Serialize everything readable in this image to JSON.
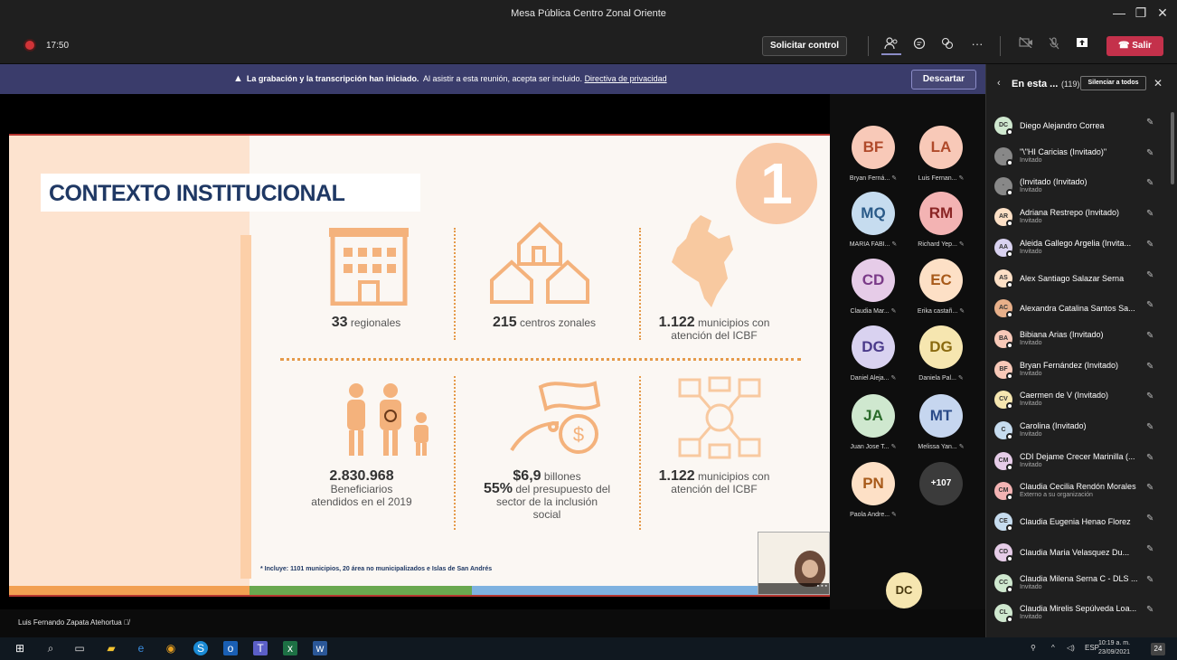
{
  "window": {
    "title": "Mesa Pública Centro Zonal Oriente",
    "minimize": "—",
    "maximize": "❐",
    "close": "✕"
  },
  "toolbar": {
    "timer": "17:50",
    "request_control": "Solicitar control",
    "participants_icon": "people-icon",
    "chat_icon": "chat-icon",
    "reactions_icon": "reactions-icon",
    "more": "···",
    "leave": "Salir"
  },
  "banner": {
    "bold": "La grabación y la transcripción han iniciado.",
    "text": "Al asistir a esta reunión, acepta ser incluido.",
    "link": "Directiva de privacidad",
    "dismiss": "Descartar"
  },
  "slide": {
    "title": "CONTEXTO INSTITUCIONAL",
    "number": "1",
    "stats": [
      {
        "value": "33",
        "label": "regionales"
      },
      {
        "value": "215",
        "label": "centros zonales"
      },
      {
        "value": "1.122",
        "label": "municipios con",
        "label2": "atención del ICBF"
      },
      {
        "value": "2.830.968",
        "label": "Beneficiarios",
        "label2": "atendidos en el 2019"
      },
      {
        "value": "$6,9",
        "label": "billones",
        "value2": "55%",
        "label2": "del presupuesto del",
        "label3": "sector de la inclusión",
        "label4": "social"
      },
      {
        "value": "1.122",
        "label": "municipios con",
        "label2": "atención del ICBF"
      }
    ],
    "footnote": "* Incluye: 1101 municipios, 20 área no municipalizados e Islas de San Andrés",
    "strip_colors": [
      "#f2a052",
      "#6aa84f",
      "#7fb2e0",
      "#b5352f"
    ]
  },
  "speaker": {
    "name": "Luis Fernando Zapata Atehortua"
  },
  "gallery": [
    {
      "initials": "BF",
      "name": "Bryan Ferná...",
      "bg": "#f8c9b8",
      "fg": "#b04a2a"
    },
    {
      "initials": "LA",
      "name": "Luis Fernan...",
      "bg": "#f8c9b8",
      "fg": "#b04a2a"
    },
    {
      "initials": "MQ",
      "name": "MARIA FABI...",
      "bg": "#c6dcef",
      "fg": "#2a5a88"
    },
    {
      "initials": "RM",
      "name": "Richard Yep...",
      "bg": "#f3b3b3",
      "fg": "#8a2424"
    },
    {
      "initials": "CD",
      "name": "Claudia Mar...",
      "bg": "#e6cce8",
      "fg": "#7a3a88"
    },
    {
      "initials": "EC",
      "name": "Erika castañ...",
      "bg": "#fde0c6",
      "fg": "#a85a1a"
    },
    {
      "initials": "DG",
      "name": "Daniel Aleja...",
      "bg": "#d9d2f0",
      "fg": "#4a3a8a"
    },
    {
      "initials": "DG",
      "name": "Daniela Pal...",
      "bg": "#f6e6b0",
      "fg": "#8a6a10"
    },
    {
      "initials": "JA",
      "name": "Juan Jose T...",
      "bg": "#cfe8cf",
      "fg": "#2a6a2a"
    },
    {
      "initials": "MT",
      "name": "Melissa Yan...",
      "bg": "#c6d6ef",
      "fg": "#2a4a88"
    },
    {
      "initials": "PN",
      "name": "Paola Andre...",
      "bg": "#fde0c6",
      "fg": "#a85a1a"
    }
  ],
  "gallery_more": "+107",
  "gallery_bottom_initials": "DC",
  "panel": {
    "title": "En esta ...",
    "count": "(119)",
    "mute_all": "Silenciar a todos",
    "back": "‹",
    "close": "✕",
    "participants": [
      {
        "initials": "DC",
        "name": "Diego Alejandro Correa",
        "sub": "",
        "bg": "#cfe8cf"
      },
      {
        "initials": "·",
        "name": "\"\\\"HI Caricias (Invitado)\"",
        "sub": "Invitado",
        "bg": "#888"
      },
      {
        "initials": "·",
        "name": "(Invitado (Invitado)",
        "sub": "Invitado",
        "bg": "#888"
      },
      {
        "initials": "AR",
        "name": "Adriana Restrepo (Invitado)",
        "sub": "Invitado",
        "bg": "#fde0c6"
      },
      {
        "initials": "AA",
        "name": "Aleida Gallego Argelia (Invita...",
        "sub": "Invitado",
        "bg": "#d9d2f0"
      },
      {
        "initials": "AS",
        "name": "Alex Santiago Salazar Serna",
        "sub": "",
        "bg": "#fde0c6"
      },
      {
        "initials": "AC",
        "name": "Alexandra Catalina Santos Sa...",
        "sub": "",
        "bg": "#e8b08a"
      },
      {
        "initials": "BA",
        "name": "Bibiana Arias (Invitado)",
        "sub": "Invitado",
        "bg": "#f8c9b8"
      },
      {
        "initials": "BF",
        "name": "Bryan Fernández (Invitado)",
        "sub": "Invitado",
        "bg": "#f8c9b8"
      },
      {
        "initials": "CV",
        "name": "Caermen de V (Invitado)",
        "sub": "Invitado",
        "bg": "#f6e6b0"
      },
      {
        "initials": "C",
        "name": "Carolina (Invitado)",
        "sub": "Invitado",
        "bg": "#c6dcef"
      },
      {
        "initials": "CM",
        "name": "CDI Dejame Crecer Marinilla (...",
        "sub": "Invitado",
        "bg": "#e6cce8"
      },
      {
        "initials": "CM",
        "name": "Claudia Cecilia Rendón Morales",
        "sub": "Externo a su organización",
        "bg": "#f3b3b3"
      },
      {
        "initials": "CE",
        "name": "Claudia Eugenia Henao Florez",
        "sub": "",
        "bg": "#c6dcef"
      },
      {
        "initials": "CD",
        "name": "Claudia Maria Velasquez Du...",
        "sub": "",
        "bg": "#e6cce8"
      },
      {
        "initials": "CC",
        "name": "Claudia Milena Serna C - DLS ...",
        "sub": "Invitado",
        "bg": "#cfe8cf"
      },
      {
        "initials": "CL",
        "name": "Claudia Mirelis Sepúlveda Loa...",
        "sub": "Invitado",
        "bg": "#cfe8cf"
      }
    ]
  },
  "taskbar": {
    "lang": "ESP",
    "time": "10:19 a. m.",
    "date": "23/09/2021",
    "notifications": "24"
  }
}
